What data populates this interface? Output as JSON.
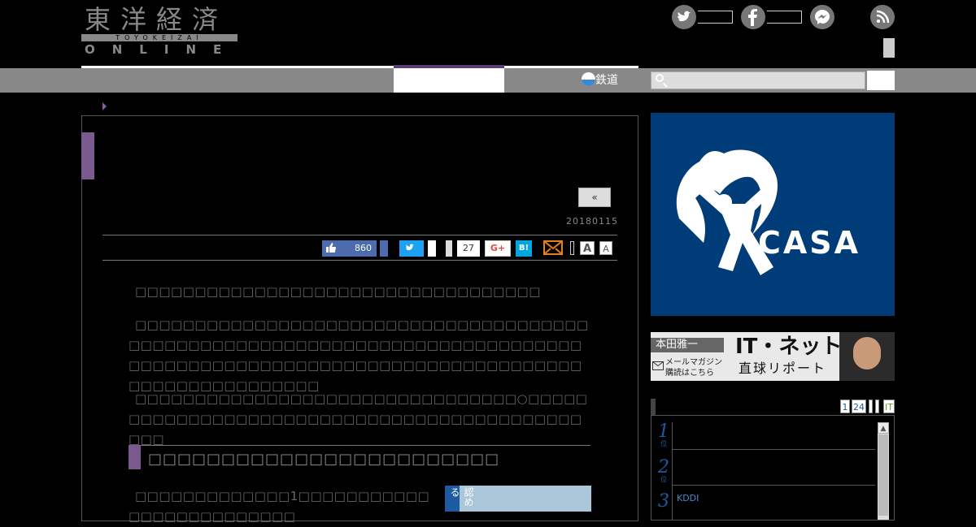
{
  "header": {
    "logo_jp": "東洋経済",
    "logo_roman": "TOYOKEIZAI",
    "logo_online": "ONLINE"
  },
  "nav": {
    "rail_label": "鉄道"
  },
  "icons": {
    "twitter": "twitter-icon",
    "facebook": "facebook-icon",
    "messenger": "messenger-icon",
    "rss": "rss-icon",
    "search": "search-icon",
    "mail": "mail-icon"
  },
  "article": {
    "prev_label": "«",
    "date": "20180115",
    "share": {
      "fb_count": "860",
      "pocket_count": "27",
      "gplus_label": "G+",
      "hatena_label": "B!",
      "font_large": "A",
      "font_small": "A"
    },
    "paragraphs": [
      "□□□□□□□□□□□□□□□□□□□□□□□□□□□□□□□□□□",
      "□□□□□□□□□□□□□□□□□□□□□□□□□□□□□□□□□□□□□□□□□□□□□□□□□□□□□□□□□□□□□□□□□□□□□□□□□□□□□□□□□□□□□□□□□□□□□□□□□□□□□□□□□□□□□□□□□□□□□□□□□□□□□□□□□□",
      "□□□□□□□□□□□□□□□□□□□□□□□□□□□□□□□□○□□□□□□□□□□□□□□□□□□□□□□□□□□□□□□□□□□□□□□□□□□□□□□"
    ],
    "heading": "□□□□□□□□□□□□□□□□□□□□□□□□",
    "last_para": "□□□□□□□□□□□□□1□□□□□□□□□□□□□□□□□□□□□□□□□",
    "book_label": "認める"
  },
  "sidebar": {
    "ad_brand": "CASA",
    "mail_banner": {
      "name": "本田雅一",
      "title_top": "IT・ネット",
      "title_bottom": "直球リポート",
      "sub1": "メールマガジン",
      "sub2": "購読はこちら"
    },
    "ranking": {
      "tabs": [
        "1",
        "24",
        "",
        "",
        "IT"
      ],
      "items": [
        {
          "rank": "1",
          "suffix": "位",
          "text": ""
        },
        {
          "rank": "2",
          "suffix": "位",
          "text": ""
        },
        {
          "rank": "3",
          "suffix": "",
          "text": "KDDI"
        }
      ]
    }
  },
  "colors": {
    "accent_purple": "#7a5a8e",
    "nav_gray": "#888888",
    "facebook": "#4e6bad",
    "twitter": "#1da1f2",
    "hatena": "#00a4de",
    "casa_blue": "#003c78"
  }
}
